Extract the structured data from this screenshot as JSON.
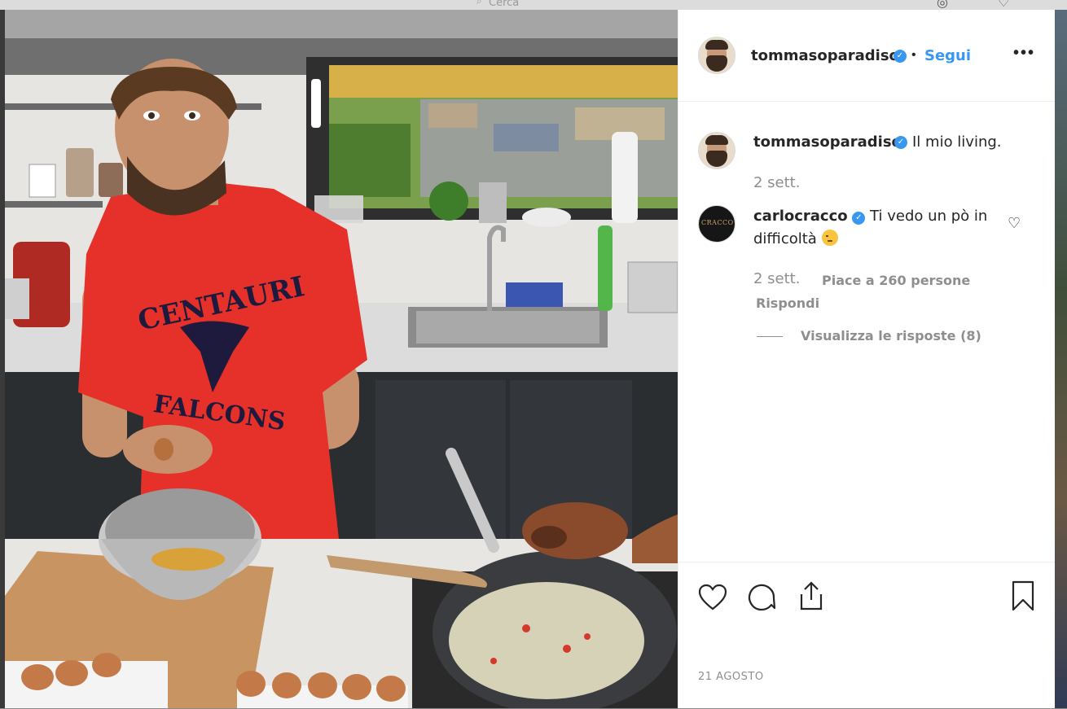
{
  "topbar": {
    "search_placeholder": "Cerca"
  },
  "post": {
    "author": "tommasoparadiso",
    "follow_label": "Segui",
    "more_label": "•••",
    "dot": "•",
    "verified_mark": "✓",
    "caption": "Il mio living.",
    "caption_age": "2 sett.",
    "date": "21 AGOSTO"
  },
  "comment": {
    "author": "carlocracco",
    "text": "Ti vedo un pò in difficoltà",
    "age": "2 sett.",
    "likes": "Piace a 260 persone",
    "reply_label": "Rispondi",
    "view_replies": "Visualizza le risposte (8)",
    "avatar_logo": "CRACCO"
  },
  "photo": {
    "shirt_line1": "CENTAURI",
    "shirt_line2": "FALCONS"
  },
  "colors": {
    "link_blue": "#3897f0",
    "text": "#262626",
    "muted": "#8e8e8e",
    "shirt_red": "#e5312a"
  },
  "icons": [
    "search-icon",
    "compass-icon",
    "heart-icon",
    "comment-icon",
    "share-icon",
    "bookmark-icon",
    "more-icon",
    "verified-icon"
  ]
}
